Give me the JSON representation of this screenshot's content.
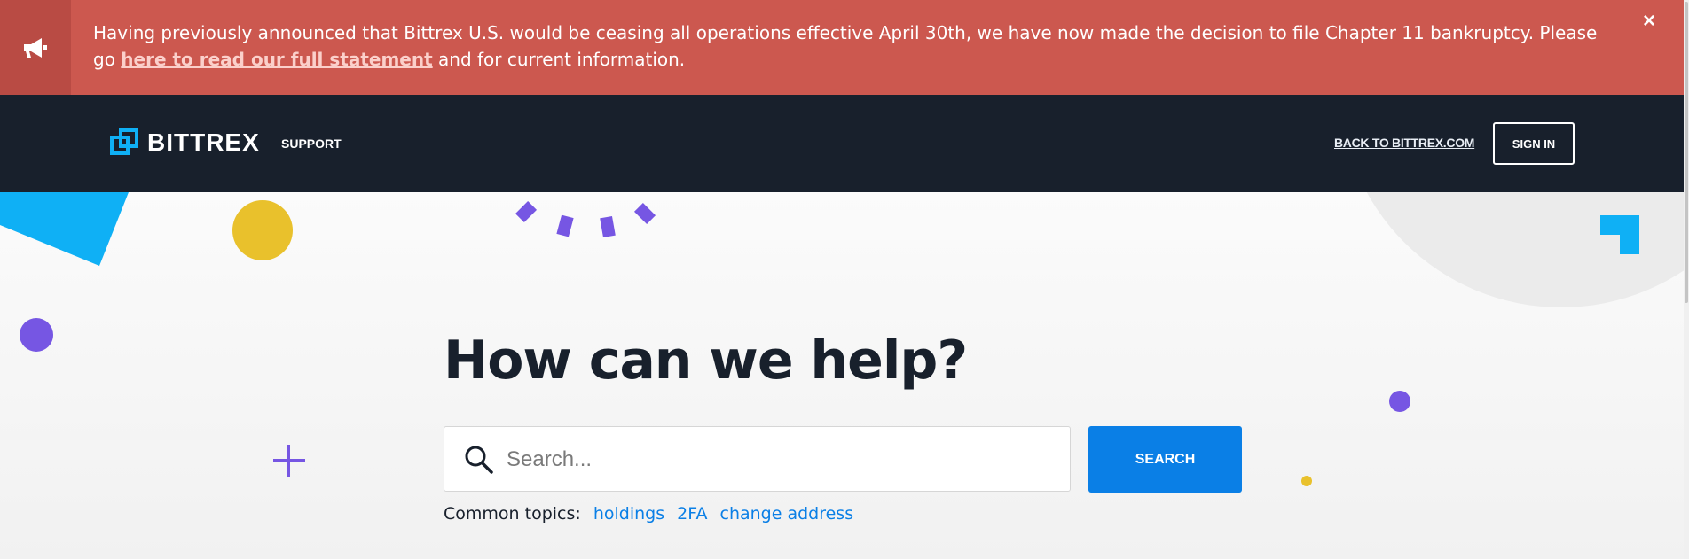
{
  "banner": {
    "message_before": "Having previously announced that Bittrex U.S. would be ceasing all operations effective April 30th, we have now made the decision to file Chapter 11 bankruptcy. Please go ",
    "link_text": "here to read our full statement",
    "message_after": " and for current information.",
    "close_label": "×",
    "icon": "megaphone-icon"
  },
  "nav": {
    "logo_text": "BITTREX",
    "support_label": "SUPPORT",
    "back_link": "BACK TO BITTREX.COM",
    "sign_in": "SIGN IN"
  },
  "hero": {
    "heading": "How can we help?",
    "search_placeholder": "Search...",
    "search_button": "SEARCH",
    "topics_label": "Common topics:",
    "topics": [
      "holdings",
      "2FA",
      "change address"
    ]
  },
  "colors": {
    "banner": "#cc584f",
    "nav": "#18202c",
    "accent": "#0a7fe6",
    "purple": "#7656e3",
    "yellow": "#e9c12c",
    "cyan": "#0fb0f5"
  }
}
